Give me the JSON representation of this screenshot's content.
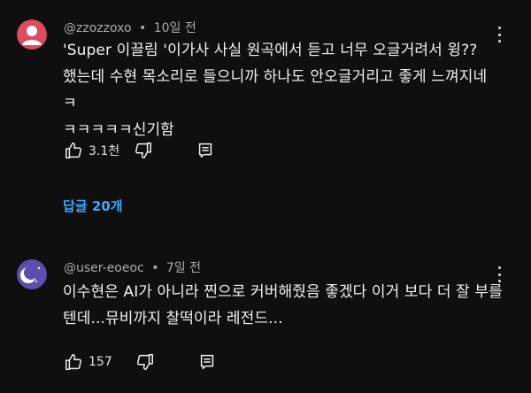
{
  "comments": [
    {
      "username": "@zzozzoxo",
      "time": "10일 전",
      "text": "'Super 이끌림 '이가사  사실 원곡에서 듣고 너무 오글거려서 윙??\n했는데 수현 목소리로 들으니까 하나도 안오글거리고 좋게 느껴지네 ㅋ\nㅋㅋㅋㅋㅋ신기함",
      "likes": "3.1천",
      "avatar_color": "#e04a5f",
      "replies_label": "답글 20개"
    },
    {
      "username": "@user-eoeoc",
      "time": "7일 전",
      "text": "이수현은 AI가 아니라 찐으로 커버해줬음 좋겠다 이거 보다 더 잘 부를\n텐데...뮤비까지 찰떡이라 레전드...",
      "likes": "157",
      "avatar_color": "#5a4fb0"
    }
  ],
  "separator": "•",
  "icons": {
    "like": "thumbs-up-icon",
    "dislike": "thumbs-down-icon",
    "reply": "reply-comment-icon",
    "more": "more-vertical-icon"
  },
  "colors": {
    "background": "#0f0f0f",
    "text": "#f1f1f1",
    "meta": "#aaaaaa",
    "link": "#3ea6ff"
  }
}
